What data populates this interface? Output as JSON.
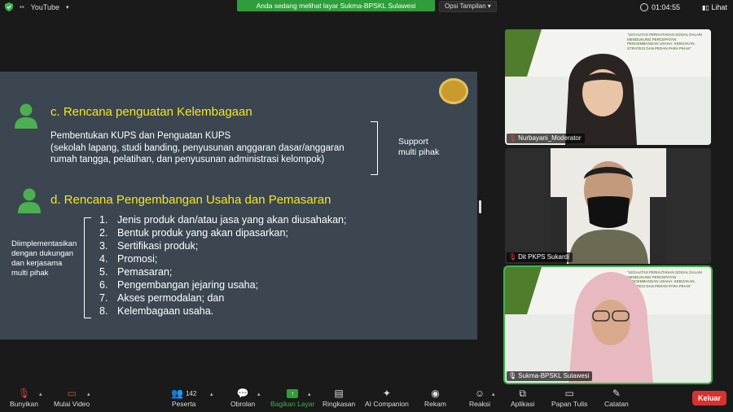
{
  "topbar": {
    "app_source": "YouTube",
    "share_banner": "Anda sedang melihat layar Sukma-BPSKL Sulawesi",
    "view_options": "Opsi Tampilan",
    "view_options_caret": "▾",
    "timer": "01:04:55",
    "view_label": "Lihat"
  },
  "slide": {
    "heading_c": "c. Rencana penguatan Kelembagaan",
    "para_c_line1": "Pembentukan KUPS dan Penguatan KUPS",
    "para_c_line2": "(sekolah lapang, studi banding, penyusunan anggaran dasar/anggaran",
    "para_c_line3": "rumah tangga, pelatihan, dan penyusunan administrasi kelompok)",
    "support_line1": "Support",
    "support_line2": "multi pihak",
    "heading_d": "d. Rencana Pengembangan Usaha dan Pemasaran",
    "side_note_line1": "Diimplementasikan",
    "side_note_line2": "dengan dukungan",
    "side_note_line3": "dan kerjasama",
    "side_note_line4": "multi pihak",
    "list": [
      {
        "num": "1.",
        "text": "Jenis produk dan/atau jasa yang akan diusahakan;"
      },
      {
        "num": "2.",
        "text": "Bentuk produk yang akan dipasarkan;"
      },
      {
        "num": "3.",
        "text": "Sertifikasi produk;"
      },
      {
        "num": "4.",
        "text": "Promosi;"
      },
      {
        "num": "5.",
        "text": "Pemasaran;"
      },
      {
        "num": "6.",
        "text": "Pengembangan jejaring usaha;"
      },
      {
        "num": "7.",
        "text": "Akses permodalan; dan"
      },
      {
        "num": "8.",
        "text": "Kelembagaan usaha."
      }
    ]
  },
  "participants": [
    {
      "name": "Nurbayani_Moderator"
    },
    {
      "name": "Dit PKPS Sukardi"
    },
    {
      "name": "Sukma-BPSKL Sulawesi"
    }
  ],
  "banner_text": "\"LEGALITAS PERHUTANAN SOSIAL DALAM MENDUKUNG PERCEPATAN PENGEMBANGAN USAHA: KEBIJAKAN, STRATEGI DAN PERAN PARA PIHAK\"",
  "toolbar": {
    "unmute": "Bunyikan",
    "start_video": "Mulai Video",
    "participants": "Peserta",
    "participants_count": "142",
    "chat": "Obrolan",
    "share_screen": "Bagikan Layar",
    "summary": "Ringkasan",
    "ai_companion": "AI Companion",
    "record": "Rekam",
    "reactions": "Reaksi",
    "apps": "Aplikasi",
    "whiteboard": "Papan Tulis",
    "notes": "Catatan",
    "leave": "Keluar"
  },
  "colors": {
    "slide_bg": "#3b4651",
    "heading_yellow": "#f7e51d",
    "person_icon_green": "#4caf50",
    "share_green": "#2f9e3a",
    "leave_red": "#d8322f",
    "active_speaker": "#3bb54a"
  }
}
